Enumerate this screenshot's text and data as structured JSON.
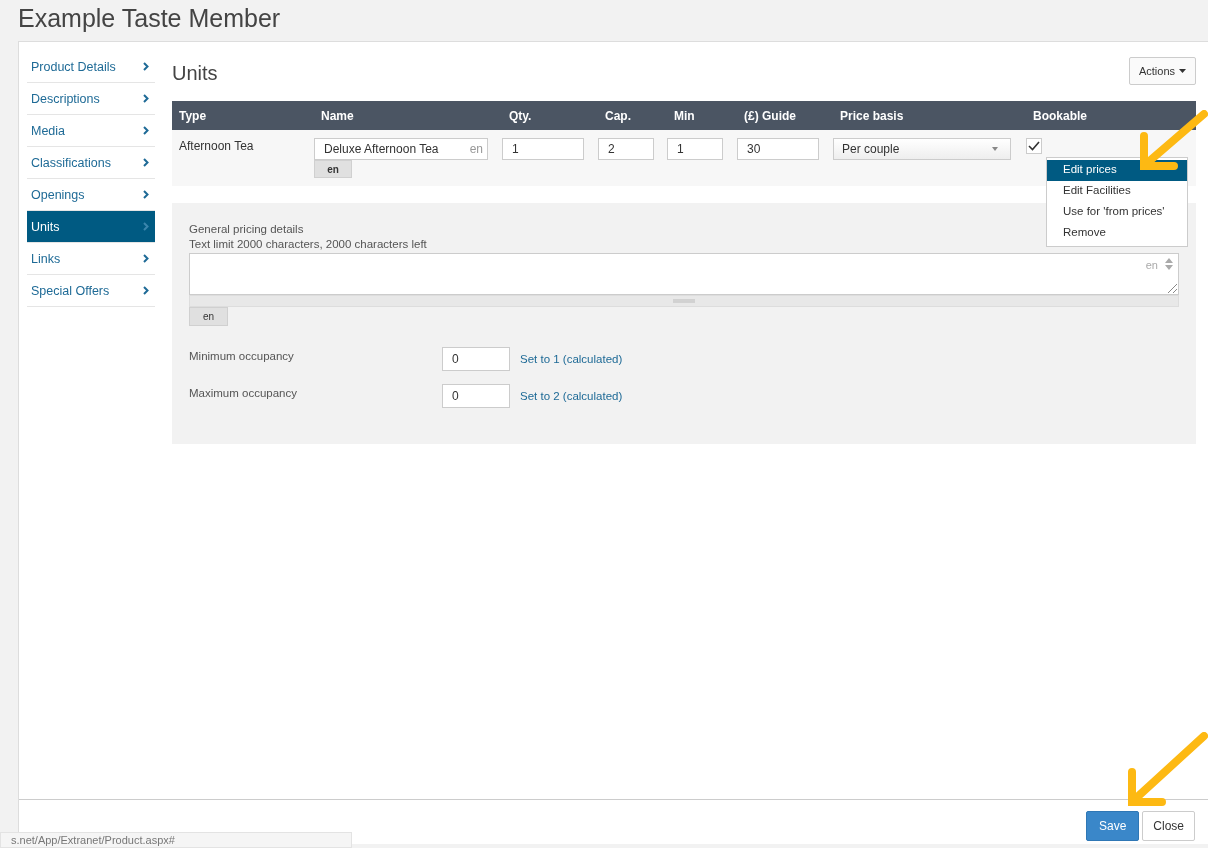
{
  "title": "Example Taste Member",
  "sidebar": {
    "items": [
      {
        "label": "Product Details",
        "selected": false
      },
      {
        "label": "Descriptions",
        "selected": false
      },
      {
        "label": "Media",
        "selected": false
      },
      {
        "label": "Classifications",
        "selected": false
      },
      {
        "label": "Openings",
        "selected": false
      },
      {
        "label": "Units",
        "selected": true
      },
      {
        "label": "Links",
        "selected": false
      },
      {
        "label": "Special Offers",
        "selected": false
      }
    ]
  },
  "heading": "Units",
  "actions_button": "Actions",
  "table": {
    "columns": [
      "Type",
      "Name",
      "Qty.",
      "Cap.",
      "Min",
      "(£) Guide",
      "Price basis",
      "Bookable"
    ],
    "rows": [
      {
        "type": "Afternoon Tea",
        "name": "Deluxe Afternoon Tea",
        "name_lang": "en",
        "lang_button": "en",
        "qty": "1",
        "cap": "2",
        "min": "1",
        "guide": "30",
        "price_basis": "Per couple",
        "bookable": true
      }
    ]
  },
  "context_menu": {
    "items": [
      {
        "label": "Edit prices",
        "selected": true
      },
      {
        "label": "Edit Facilities",
        "selected": false
      },
      {
        "label": "Use for 'from prices'",
        "selected": false
      },
      {
        "label": "Remove",
        "selected": false
      }
    ]
  },
  "pricing": {
    "label": "General pricing details",
    "limit_text": "Text limit 2000 characters, 2000 characters left",
    "field_lang": "en",
    "lang_button": "en",
    "occupancy": [
      {
        "label": "Minimum occupancy",
        "value": "0",
        "link": "Set to 1 (calculated)"
      },
      {
        "label": "Maximum occupancy",
        "value": "0",
        "link": "Set to 2 (calculated)"
      }
    ]
  },
  "footer_buttons": [
    {
      "label": "Save",
      "kind": "primary"
    },
    {
      "label": "Close",
      "kind": "default"
    }
  ],
  "status_url": "s.net/App/Extranet/Product.aspx#"
}
